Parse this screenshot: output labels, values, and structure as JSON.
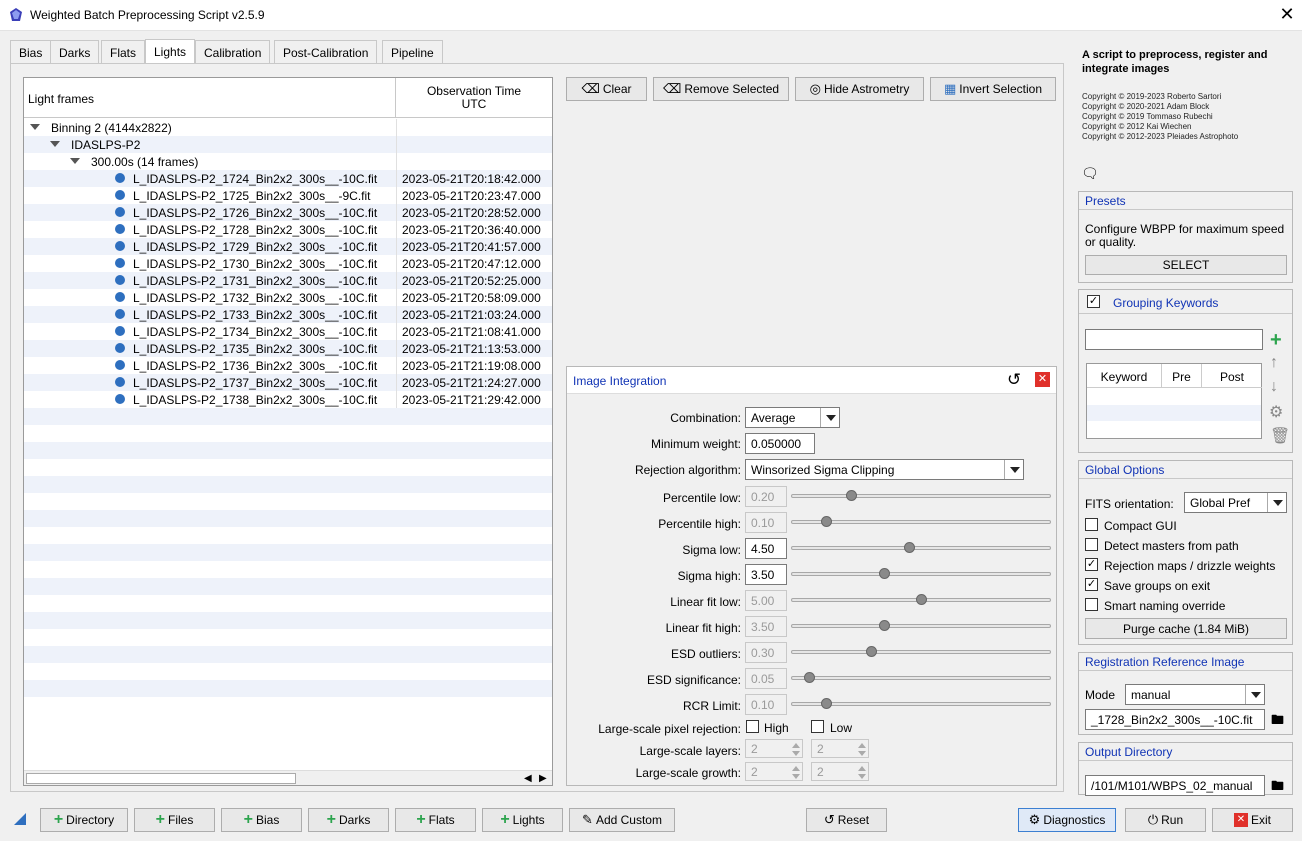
{
  "window": {
    "title": "Weighted Batch Preprocessing Script v2.5.9",
    "close": "✕"
  },
  "tabs": [
    "Bias",
    "Darks",
    "Flats",
    "Lights",
    "Calibration",
    "Post-Calibration",
    "Pipeline"
  ],
  "active_tab": "Lights",
  "tree": {
    "col1": "Light frames",
    "col2_line1": "Observation Time",
    "col2_line2": "UTC",
    "group1": "Binning 2 (4144x2822)",
    "group2": "IDASLPS-P2",
    "group3": "300.00s (14 frames)",
    "frames": [
      {
        "name": "L_IDASLPS-P2_1724_Bin2x2_300s__-10C.fit",
        "time": "2023-05-21T20:18:42.000"
      },
      {
        "name": "L_IDASLPS-P2_1725_Bin2x2_300s__-9C.fit",
        "time": "2023-05-21T20:23:47.000"
      },
      {
        "name": "L_IDASLPS-P2_1726_Bin2x2_300s__-10C.fit",
        "time": "2023-05-21T20:28:52.000"
      },
      {
        "name": "L_IDASLPS-P2_1728_Bin2x2_300s__-10C.fit",
        "time": "2023-05-21T20:36:40.000"
      },
      {
        "name": "L_IDASLPS-P2_1729_Bin2x2_300s__-10C.fit",
        "time": "2023-05-21T20:41:57.000"
      },
      {
        "name": "L_IDASLPS-P2_1730_Bin2x2_300s__-10C.fit",
        "time": "2023-05-21T20:47:12.000"
      },
      {
        "name": "L_IDASLPS-P2_1731_Bin2x2_300s__-10C.fit",
        "time": "2023-05-21T20:52:25.000"
      },
      {
        "name": "L_IDASLPS-P2_1732_Bin2x2_300s__-10C.fit",
        "time": "2023-05-21T20:58:09.000"
      },
      {
        "name": "L_IDASLPS-P2_1733_Bin2x2_300s__-10C.fit",
        "time": "2023-05-21T21:03:24.000"
      },
      {
        "name": "L_IDASLPS-P2_1734_Bin2x2_300s__-10C.fit",
        "time": "2023-05-21T21:08:41.000"
      },
      {
        "name": "L_IDASLPS-P2_1735_Bin2x2_300s__-10C.fit",
        "time": "2023-05-21T21:13:53.000"
      },
      {
        "name": "L_IDASLPS-P2_1736_Bin2x2_300s__-10C.fit",
        "time": "2023-05-21T21:19:08.000"
      },
      {
        "name": "L_IDASLPS-P2_1737_Bin2x2_300s__-10C.fit",
        "time": "2023-05-21T21:24:27.000"
      },
      {
        "name": "L_IDASLPS-P2_1738_Bin2x2_300s__-10C.fit",
        "time": "2023-05-21T21:29:42.000"
      }
    ]
  },
  "toolbar": {
    "clear": "Clear",
    "remove_selected": "Remove Selected",
    "hide_astrometry": "Hide Astrometry",
    "invert_selection": "Invert Selection"
  },
  "integration": {
    "title": "Image Integration",
    "combination_label": "Combination:",
    "combination": "Average",
    "min_weight_label": "Minimum weight:",
    "min_weight": "0.050000",
    "rejection_label": "Rejection algorithm:",
    "rejection": "Winsorized Sigma Clipping",
    "params": [
      {
        "label": "Percentile low:",
        "value": "0.20",
        "enabled": false,
        "level": 0.22
      },
      {
        "label": "Percentile high:",
        "value": "0.10",
        "enabled": false,
        "level": 0.12
      },
      {
        "label": "Sigma low:",
        "value": "4.50",
        "enabled": true,
        "level": 0.45
      },
      {
        "label": "Sigma high:",
        "value": "3.50",
        "enabled": true,
        "level": 0.35
      },
      {
        "label": "Linear fit low:",
        "value": "5.00",
        "enabled": false,
        "level": 0.5
      },
      {
        "label": "Linear fit high:",
        "value": "3.50",
        "enabled": false,
        "level": 0.35
      },
      {
        "label": "ESD outliers:",
        "value": "0.30",
        "enabled": false,
        "level": 0.3
      },
      {
        "label": "ESD significance:",
        "value": "0.05",
        "enabled": false,
        "level": 0.05
      },
      {
        "label": "RCR Limit:",
        "value": "0.10",
        "enabled": false,
        "level": 0.12
      }
    ],
    "ls_rejection_label": "Large-scale pixel rejection:",
    "ls_high": "High",
    "ls_low": "Low",
    "ls_layers_label": "Large-scale layers:",
    "ls_layers_high": "2",
    "ls_layers_low": "2",
    "ls_growth_label": "Large-scale growth:",
    "ls_growth_high": "2",
    "ls_growth_low": "2"
  },
  "sidebar": {
    "desc": "A script to preprocess, register and integrate images",
    "copyrights": [
      "Copyright © 2019-2023 Roberto Sartori",
      "Copyright © 2020-2021 Adam Block",
      "Copyright © 2019 Tommaso Rubechi",
      "Copyright © 2012 Kai Wiechen",
      "Copyright © 2012-2023 Pleiades Astrophoto"
    ],
    "presets": {
      "title": "Presets",
      "text": "Configure WBPP for maximum speed or quality.",
      "button": "SELECT"
    },
    "grouping": {
      "title": "Grouping Keywords",
      "checked": true,
      "cols": [
        "Keyword",
        "Pre",
        "Post"
      ],
      "input": ""
    },
    "global": {
      "title": "Global Options",
      "fits_label": "FITS orientation:",
      "fits_value": "Global Pref",
      "options": [
        {
          "label": "Compact GUI",
          "checked": false
        },
        {
          "label": "Detect masters from path",
          "checked": false
        },
        {
          "label": "Rejection maps / drizzle weights",
          "checked": true
        },
        {
          "label": "Save groups on exit",
          "checked": true
        },
        {
          "label": "Smart naming override",
          "checked": false
        }
      ],
      "purge": "Purge cache (1.84 MiB)"
    },
    "regref": {
      "title": "Registration Reference Image",
      "mode_label": "Mode",
      "mode": "manual",
      "file": "_1728_Bin2x2_300s__-10C.fit"
    },
    "output": {
      "title": "Output Directory",
      "path": "/101/M101/WBPS_02_manual"
    }
  },
  "bottom": {
    "directory": "Directory",
    "files": "Files",
    "bias": "Bias",
    "darks": "Darks",
    "flats": "Flats",
    "lights": "Lights",
    "add_custom": "Add Custom",
    "reset": "Reset",
    "diagnostics": "Diagnostics",
    "run": "Run",
    "exit": "Exit"
  },
  "colors": {
    "accent": "#1033b5",
    "dot": "#2e6fbf",
    "green": "#2da44e",
    "red": "#e0302a"
  }
}
